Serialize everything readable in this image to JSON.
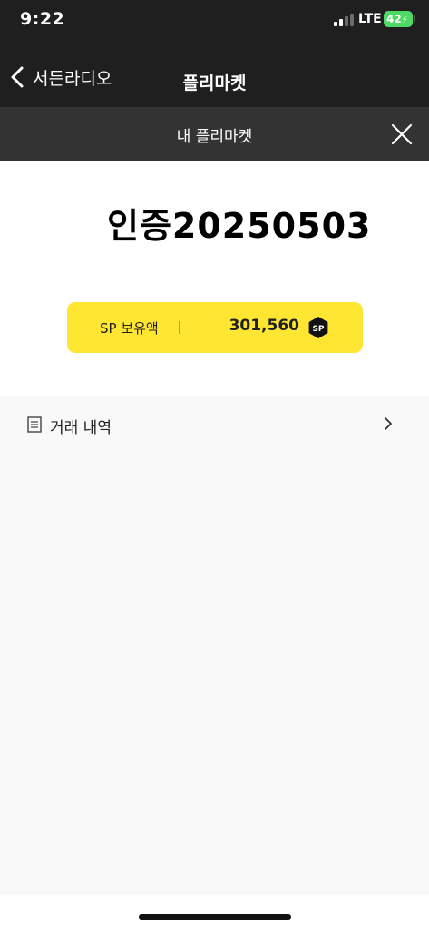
{
  "status_bar": {
    "time": "9:22",
    "network": "LTE",
    "battery": "42"
  },
  "nav": {
    "back_label": "서든라디오",
    "title": "플리마켓"
  },
  "sub_header": {
    "title": "내 플리마켓"
  },
  "profile": {
    "name": "인증20250503"
  },
  "sp_card": {
    "label": "SP 보유액",
    "amount": "301,560",
    "badge": "SP"
  },
  "menu": {
    "items": [
      {
        "label": "거래 내역"
      }
    ]
  },
  "colors": {
    "header": "#1f1f1f",
    "subheader": "#333333",
    "accent_yellow": "#ffe632"
  }
}
